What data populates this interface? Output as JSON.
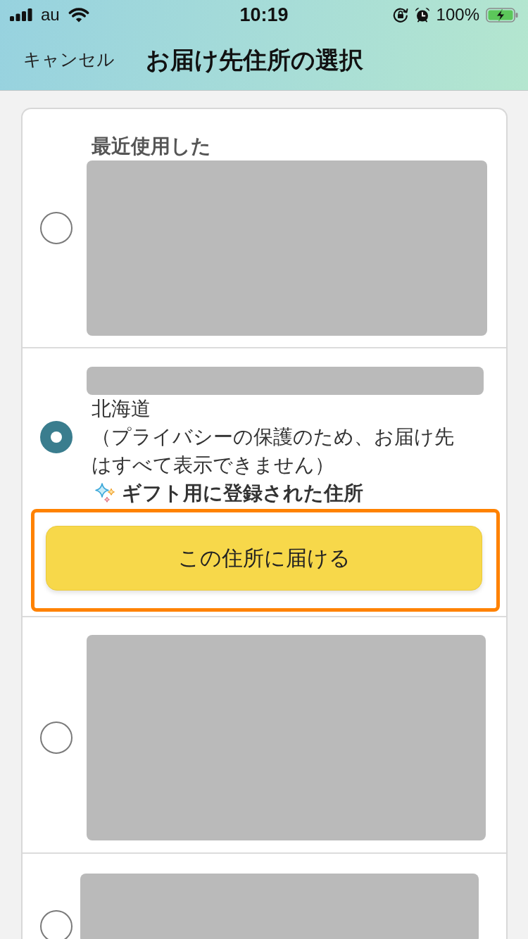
{
  "status_bar": {
    "carrier": "au",
    "time": "10:19",
    "battery": "100%"
  },
  "nav": {
    "cancel": "キャンセル",
    "title": "お届け先住所の選択"
  },
  "addresses": [
    {
      "kind": "recent",
      "selected": false,
      "label": "最近使用した"
    },
    {
      "kind": "gift",
      "selected": true,
      "prefecture": "北海道",
      "note": "（プライバシーの保護のため、お届け先はすべて表示できません）",
      "gift_label": "ギフト用に登録された住所",
      "button": "この住所に届ける",
      "highlighted": true
    },
    {
      "kind": "plain",
      "selected": false
    },
    {
      "kind": "plain",
      "selected": false
    }
  ]
}
